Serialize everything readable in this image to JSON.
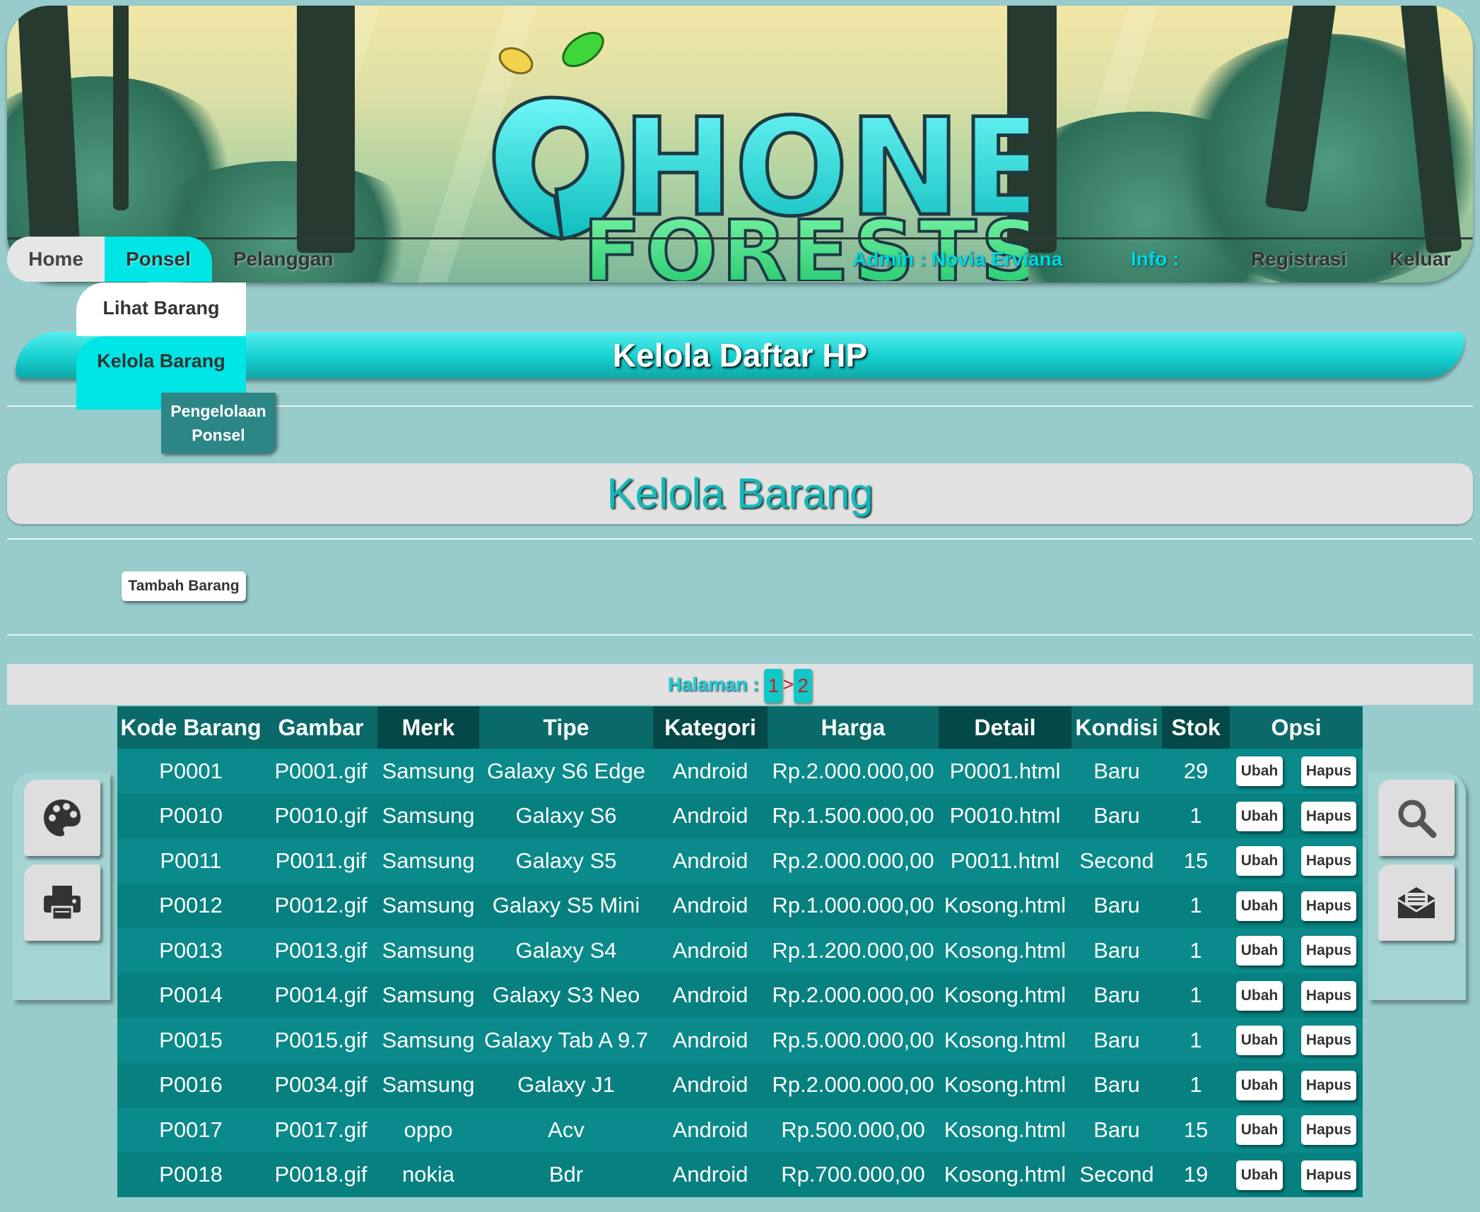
{
  "nav": {
    "home": "Home",
    "ponsel": "Ponsel",
    "pelanggan": "Pelanggan",
    "admin": "Admin : Novia Erviana",
    "info": "Info :",
    "registrasi": "Registrasi",
    "keluar": "Keluar"
  },
  "dropdown": {
    "lihat_barang": "Lihat Barang",
    "kelola_barang": "Kelola Barang",
    "pengelolaan_ponsel": "Pengelolaan Ponsel"
  },
  "logo": {
    "line1": "HONE",
    "line2": "FORESTS"
  },
  "page_title": "Kelola Daftar HP",
  "section_title": "Kelola Barang",
  "tambah_button": "Tambah Barang",
  "pagination": {
    "label": "Halaman :",
    "page1": "1",
    "separator": ">",
    "page2": "2"
  },
  "table": {
    "headers": [
      "Kode Barang",
      "Gambar",
      "Merk",
      "Tipe",
      "Kategori",
      "Harga",
      "Detail",
      "Kondisi",
      "Stok",
      "Opsi"
    ],
    "ubah_label": "Ubah",
    "hapus_label": "Hapus",
    "rows": [
      [
        "P0001",
        "P0001.gif",
        "Samsung",
        "Galaxy S6 Edge",
        "Android",
        "Rp.2.000.000,00",
        "P0001.html",
        "Baru",
        "29"
      ],
      [
        "P0010",
        "P0010.gif",
        "Samsung",
        "Galaxy S6",
        "Android",
        "Rp.1.500.000,00",
        "P0010.html",
        "Baru",
        "1"
      ],
      [
        "P0011",
        "P0011.gif",
        "Samsung",
        "Galaxy S5",
        "Android",
        "Rp.2.000.000,00",
        "P0011.html",
        "Second",
        "15"
      ],
      [
        "P0012",
        "P0012.gif",
        "Samsung",
        "Galaxy S5 Mini",
        "Android",
        "Rp.1.000.000,00",
        "Kosong.html",
        "Baru",
        "1"
      ],
      [
        "P0013",
        "P0013.gif",
        "Samsung",
        "Galaxy S4",
        "Android",
        "Rp.1.200.000,00",
        "Kosong.html",
        "Baru",
        "1"
      ],
      [
        "P0014",
        "P0014.gif",
        "Samsung",
        "Galaxy S3 Neo",
        "Android",
        "Rp.2.000.000,00",
        "Kosong.html",
        "Baru",
        "1"
      ],
      [
        "P0015",
        "P0015.gif",
        "Samsung",
        "Galaxy Tab A 9.7",
        "Android",
        "Rp.5.000.000,00",
        "Kosong.html",
        "Baru",
        "1"
      ],
      [
        "P0016",
        "P0034.gif",
        "Samsung",
        "Galaxy J1",
        "Android",
        "Rp.2.000.000,00",
        "Kosong.html",
        "Baru",
        "1"
      ],
      [
        "P0017",
        "P0017.gif",
        "oppo",
        "Acv",
        "Android",
        "Rp.500.000,00",
        "Kosong.html",
        "Baru",
        "15"
      ],
      [
        "P0018",
        "P0018.gif",
        "nokia",
        "Bdr",
        "Android",
        "Rp.700.000,00",
        "Kosong.html",
        "Second",
        "19"
      ]
    ]
  },
  "side_icons": {
    "left": [
      "palette-icon",
      "printer-icon"
    ],
    "right": [
      "search-icon",
      "mail-icon"
    ]
  },
  "colors": {
    "accent": "#00e5e5",
    "table_dark": "#054848",
    "background": "#98cccc"
  }
}
